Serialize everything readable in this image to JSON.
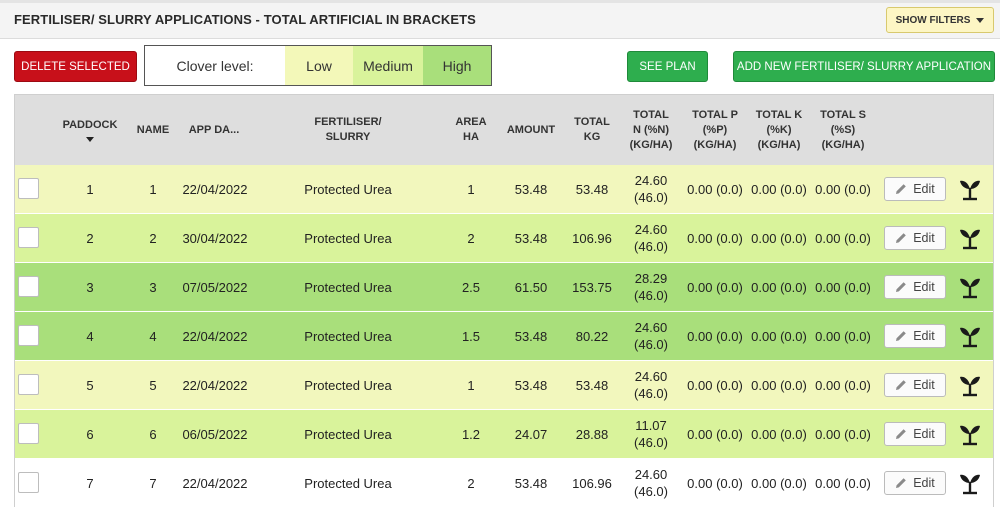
{
  "header": {
    "title": "FERTILISER/ SLURRY APPLICATIONS - TOTAL ARTIFICIAL IN BRACKETS",
    "show_filters": "SHOW FILTERS"
  },
  "toolbar": {
    "delete_label": "DELETE SELECTED",
    "clover_label": "Clover level:",
    "clover_options": [
      "Low",
      "Medium",
      "High"
    ],
    "see_plan_label": "SEE PLAN",
    "add_label": "ADD NEW FERTILISER/ SLURRY APPLICATION"
  },
  "table": {
    "columns": {
      "paddock": "PADDOCK",
      "name": "NAME",
      "app_date": "APP DA...",
      "fert_1": "FERTILISER/",
      "fert_2": "SLURRY",
      "area_1": "AREA",
      "area_2": "HA",
      "amount": "AMOUNT",
      "kg_1": "TOTAL",
      "kg_2": "KG",
      "n_1": "TOTAL",
      "n_2": "N (%N)",
      "n_3": "(KG/HA)",
      "p_1": "TOTAL P",
      "p_2": "(%P)",
      "p_3": "(KG/HA)",
      "k_1": "TOTAL K",
      "k_2": "(%K)",
      "k_3": "(KG/HA)",
      "s_1": "TOTAL S",
      "s_2": "(%S)",
      "s_3": "(KG/HA)"
    },
    "edit_label": "Edit",
    "row_colors": [
      "#f2f7bd",
      "#d9f39b",
      "#a9df7b",
      "#a9df7b",
      "#f2f7bd",
      "#d9f39b",
      "#ffffff"
    ],
    "rows": [
      {
        "paddock": "1",
        "name": "1",
        "date": "22/04/2022",
        "fert": "Protected Urea",
        "area": "1",
        "amount": "53.48",
        "total_kg": "53.48",
        "n_top": "24.60",
        "n_bottom": "(46.0)",
        "p": "0.00 (0.0)",
        "k": "0.00 (0.0)",
        "s": "0.00 (0.0)"
      },
      {
        "paddock": "2",
        "name": "2",
        "date": "30/04/2022",
        "fert": "Protected Urea",
        "area": "2",
        "amount": "53.48",
        "total_kg": "106.96",
        "n_top": "24.60",
        "n_bottom": "(46.0)",
        "p": "0.00 (0.0)",
        "k": "0.00 (0.0)",
        "s": "0.00 (0.0)"
      },
      {
        "paddock": "3",
        "name": "3",
        "date": "07/05/2022",
        "fert": "Protected Urea",
        "area": "2.5",
        "amount": "61.50",
        "total_kg": "153.75",
        "n_top": "28.29",
        "n_bottom": "(46.0)",
        "p": "0.00 (0.0)",
        "k": "0.00 (0.0)",
        "s": "0.00 (0.0)"
      },
      {
        "paddock": "4",
        "name": "4",
        "date": "22/04/2022",
        "fert": "Protected Urea",
        "area": "1.5",
        "amount": "53.48",
        "total_kg": "80.22",
        "n_top": "24.60",
        "n_bottom": "(46.0)",
        "p": "0.00 (0.0)",
        "k": "0.00 (0.0)",
        "s": "0.00 (0.0)"
      },
      {
        "paddock": "5",
        "name": "5",
        "date": "22/04/2022",
        "fert": "Protected Urea",
        "area": "1",
        "amount": "53.48",
        "total_kg": "53.48",
        "n_top": "24.60",
        "n_bottom": "(46.0)",
        "p": "0.00 (0.0)",
        "k": "0.00 (0.0)",
        "s": "0.00 (0.0)"
      },
      {
        "paddock": "6",
        "name": "6",
        "date": "06/05/2022",
        "fert": "Protected Urea",
        "area": "1.2",
        "amount": "24.07",
        "total_kg": "28.88",
        "n_top": "11.07",
        "n_bottom": "(46.0)",
        "p": "0.00 (0.0)",
        "k": "0.00 (0.0)",
        "s": "0.00 (0.0)"
      },
      {
        "paddock": "7",
        "name": "7",
        "date": "22/04/2022",
        "fert": "Protected Urea",
        "area": "2",
        "amount": "53.48",
        "total_kg": "106.96",
        "n_top": "24.60",
        "n_bottom": "(46.0)",
        "p": "0.00 (0.0)",
        "k": "0.00 (0.0)",
        "s": "0.00 (0.0)"
      }
    ]
  },
  "icons": {
    "edit": "pencil-icon",
    "plan": "plant-sprout-icon",
    "filters": "chevron-down-icon",
    "sort": "sort-descending-icon"
  }
}
